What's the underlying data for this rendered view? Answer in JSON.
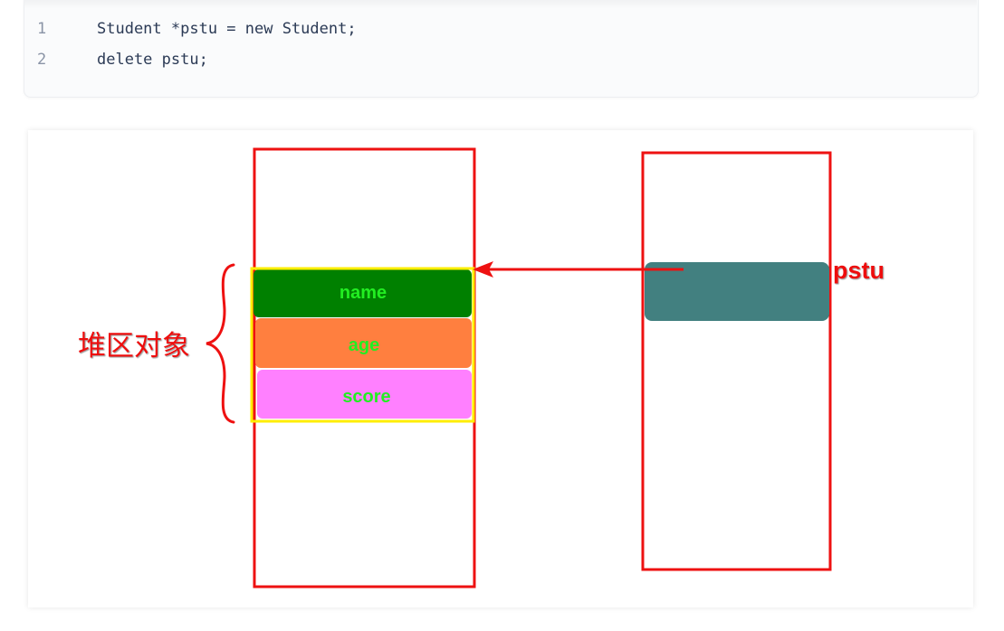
{
  "code": {
    "lines": [
      {
        "number": "1",
        "text": "Student *pstu = new Student;"
      },
      {
        "number": "2",
        "text": "delete pstu;"
      }
    ]
  },
  "diagram": {
    "fields": [
      {
        "label": "name",
        "color": "#008000"
      },
      {
        "label": "age",
        "color": "#ff7f3f"
      },
      {
        "label": "score",
        "color": "#ff80ff"
      }
    ],
    "field_text_color": "#22ee22",
    "pointer_label": "pstu",
    "pointer_box_color": "#428080",
    "heap_label": "堆区对象",
    "frame_color": "#ee1111",
    "object_border_color": "#ffee00"
  }
}
